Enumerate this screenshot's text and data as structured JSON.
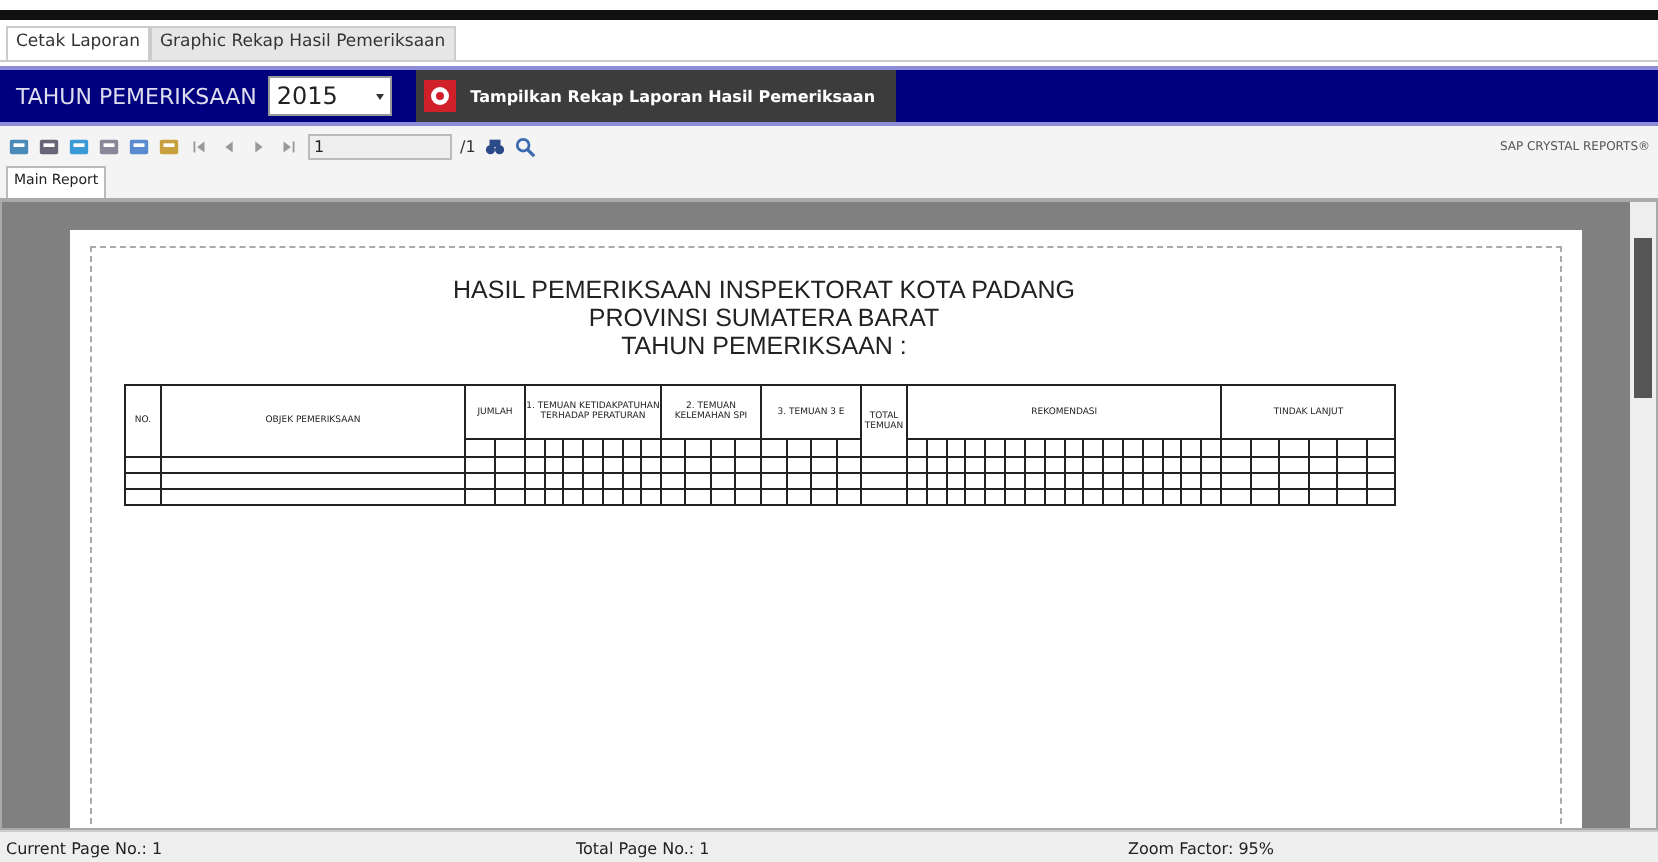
{
  "tabs": [
    {
      "label": "Cetak Laporan",
      "selected": true
    },
    {
      "label": "Graphic Rekap Hasil Pemeriksaan",
      "selected": false
    }
  ],
  "filter_bar": {
    "label": "TAHUN PEMERIKSAAN",
    "year": "2015",
    "button": "Tampilkan Rekap Laporan Hasil Pemeriksaan"
  },
  "toolbar": {
    "page": "1",
    "page_total": "/1",
    "brand": "SAP CRYSTAL REPORTS®"
  },
  "report_tabs": [
    {
      "label": "Main Report",
      "selected": true
    }
  ],
  "report": {
    "title_lines": [
      "HASIL PEMERIKSAAN INSPEKTORAT KOTA PADANG",
      "PROVINSI SUMATERA BARAT",
      "TAHUN PEMERIKSAAN :"
    ],
    "columns": [
      "NO.",
      "OBJEK PEMERIKSAAN",
      "JUMLAH",
      "1. TEMUAN KETIDAKPATUHAN TERHADAP PERATURAN",
      "2. TEMUAN KELEMAHAN SPI",
      "3. TEMUAN 3 E",
      "TOTAL TEMUAN",
      "REKOMENDASI",
      "TINDAK LANJUT"
    ]
  },
  "status_bar": [
    "Current Page No.: 1",
    "Total Page No.: 1",
    "Zoom Factor: 95%"
  ]
}
